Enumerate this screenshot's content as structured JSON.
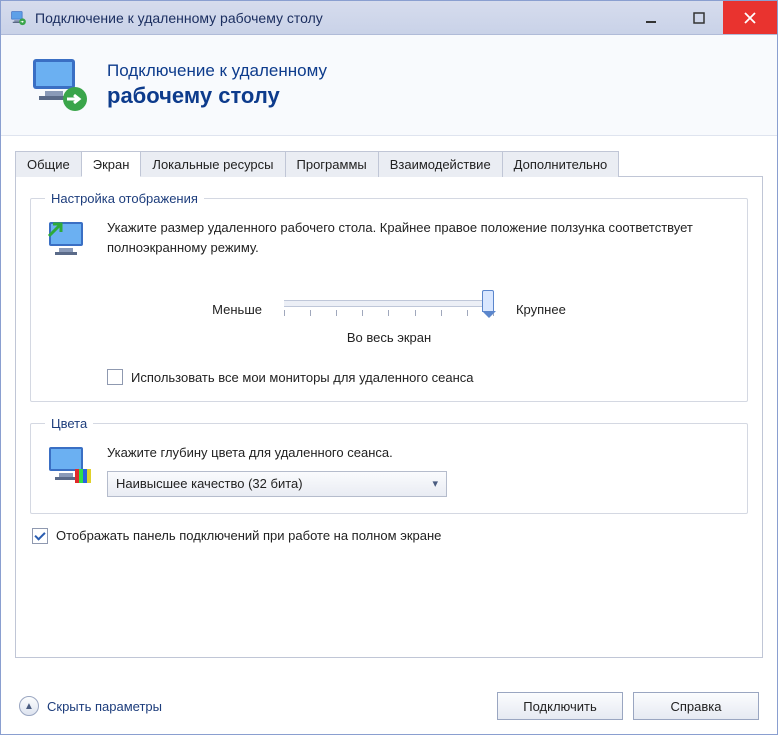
{
  "window": {
    "title": "Подключение к удаленному рабочему столу"
  },
  "banner": {
    "line1": "Подключение к удаленному",
    "line2": "рабочему столу"
  },
  "tabs": [
    {
      "id": "general",
      "label": "Общие"
    },
    {
      "id": "display",
      "label": "Экран"
    },
    {
      "id": "local",
      "label": "Локальные ресурсы"
    },
    {
      "id": "programs",
      "label": "Программы"
    },
    {
      "id": "experience",
      "label": "Взаимодействие"
    },
    {
      "id": "advanced",
      "label": "Дополнительно"
    }
  ],
  "display_group": {
    "legend": "Настройка отображения",
    "description": "Укажите размер удаленного рабочего стола. Крайнее правое положение ползунка соответствует полноэкранному режиму.",
    "slider": {
      "label_left": "Меньше",
      "label_right": "Крупнее",
      "caption": "Во весь экран"
    },
    "use_all_monitors": {
      "label": "Использовать все мои мониторы для удаленного сеанса",
      "checked": false
    }
  },
  "colors_group": {
    "legend": "Цвета",
    "description": "Укажите глубину цвета для удаленного сеанса.",
    "dropdown_value": "Наивысшее качество (32 бита)"
  },
  "show_connection_bar": {
    "label": "Отображать панель подключений при работе на полном экране",
    "checked": true
  },
  "footer": {
    "hide_params": "Скрыть параметры",
    "connect": "Подключить",
    "help": "Справка"
  }
}
